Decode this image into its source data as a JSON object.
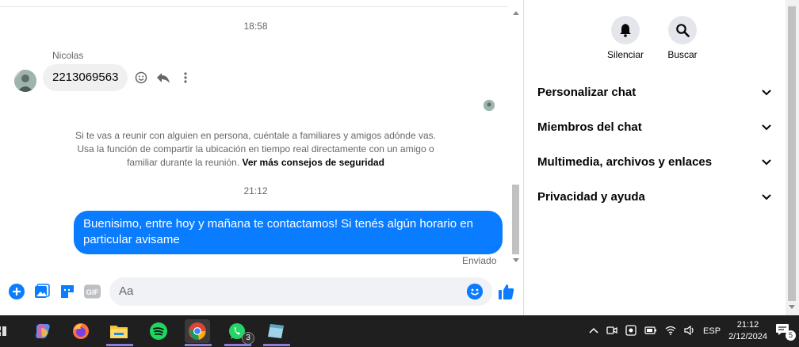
{
  "chat": {
    "timestamps": [
      "18:58",
      "21:12"
    ],
    "sender": "Nicolas",
    "incoming_message": "2213069563",
    "safety_text": "Si te vas a reunir con alguien en persona, cuéntale a familiares y amigos adónde vas. Usa la función de compartir la ubicación en tiempo real directamente con un amigo o familiar durante la reunión.",
    "safety_link": "Ver más consejos de seguridad",
    "outgoing_message": "Buenisimo, entre hoy y mañana te contactamos! Si tenés algún horario en particular avisame",
    "status": "Enviado",
    "composer_placeholder": "Aa",
    "gif_label": "GIF"
  },
  "side": {
    "buttons": [
      "Silenciar",
      "Buscar"
    ],
    "sections": [
      "Personalizar chat",
      "Miembros del chat",
      "Multimedia, archivos y enlaces",
      "Privacidad y ayuda"
    ]
  },
  "taskbar": {
    "whatsapp_badge": "3",
    "language": "ESP",
    "time": "21:12",
    "date": "2/12/2024",
    "notifications": "5"
  },
  "colors": {
    "accent": "#0a7cff",
    "bubble_in": "#f0f0f0",
    "taskbar": "#1f1f1f"
  }
}
